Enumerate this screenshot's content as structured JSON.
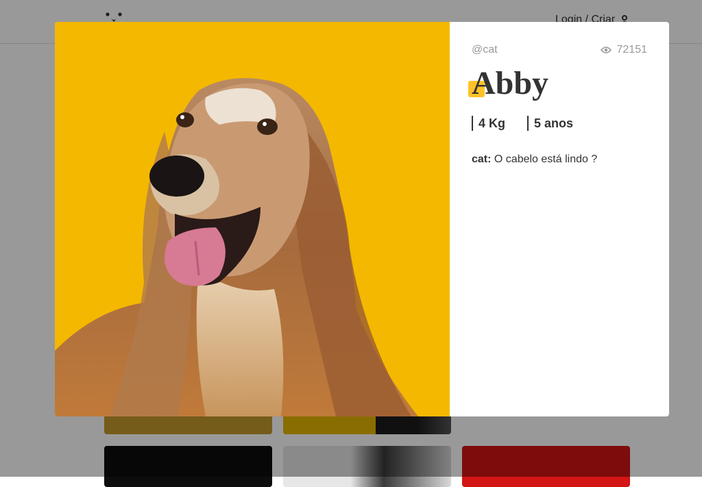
{
  "header": {
    "login_label": "Login / Criar",
    "logo_icon": "dog-face-icon",
    "user_icon": "user-icon"
  },
  "photo": {
    "alt": "Abby"
  },
  "post": {
    "author": "@cat",
    "views": "72151",
    "views_icon": "eye-icon",
    "title": "Abby",
    "weight": "4 Kg",
    "age": "5 anos",
    "comments": [
      {
        "author": "cat:",
        "text": "O cabelo está lindo ?"
      }
    ]
  },
  "colors": {
    "accent": "#ffbb11",
    "photo_bg": "#f4b800",
    "overlay": "rgba(0,0,0,0.4)"
  }
}
